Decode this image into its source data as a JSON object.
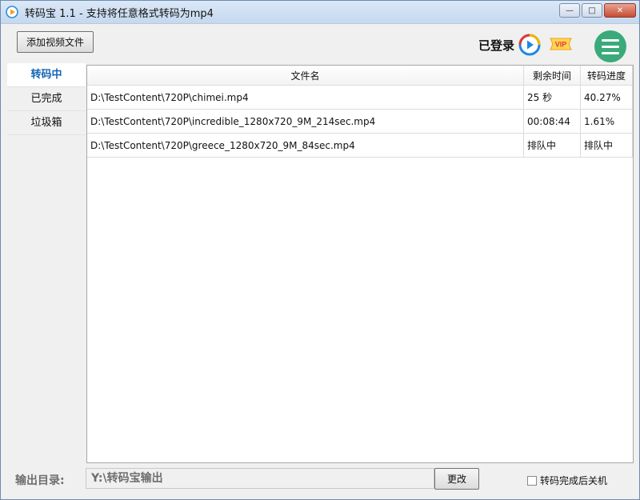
{
  "window": {
    "title": "转码宝 1.1 - 支持将任意格式转码为mp4",
    "minimize": "—",
    "maximize": "□",
    "close": "✕"
  },
  "toolbar": {
    "add_button": "添加视频文件",
    "login_status": "已登录",
    "vip_badge": "VIP"
  },
  "sidebar": {
    "items": [
      {
        "label": "转码中",
        "active": true
      },
      {
        "label": "已完成",
        "active": false
      },
      {
        "label": "垃圾箱",
        "active": false
      }
    ]
  },
  "table": {
    "headers": [
      "文件名",
      "剩余时间",
      "转码进度"
    ],
    "rows": [
      {
        "file": "D:\\TestContent\\720P\\chimei.mp4",
        "remaining": "25 秒",
        "progress": "40.27%"
      },
      {
        "file": "D:\\TestContent\\720P\\incredible_1280x720_9M_214sec.mp4",
        "remaining": "00:08:44",
        "progress": "1.61%"
      },
      {
        "file": "D:\\TestContent\\720P\\greece_1280x720_9M_84sec.mp4",
        "remaining": "排队中",
        "progress": "排队中"
      }
    ]
  },
  "footer": {
    "output_label": "输出目录:",
    "output_path": "Y:\\转码宝输出",
    "change_button": "更改",
    "shutdown_label": "转码完成后关机",
    "shutdown_checked": false
  },
  "colors": {
    "accent": "#1565b4",
    "menu_button": "#3aaa7a"
  }
}
